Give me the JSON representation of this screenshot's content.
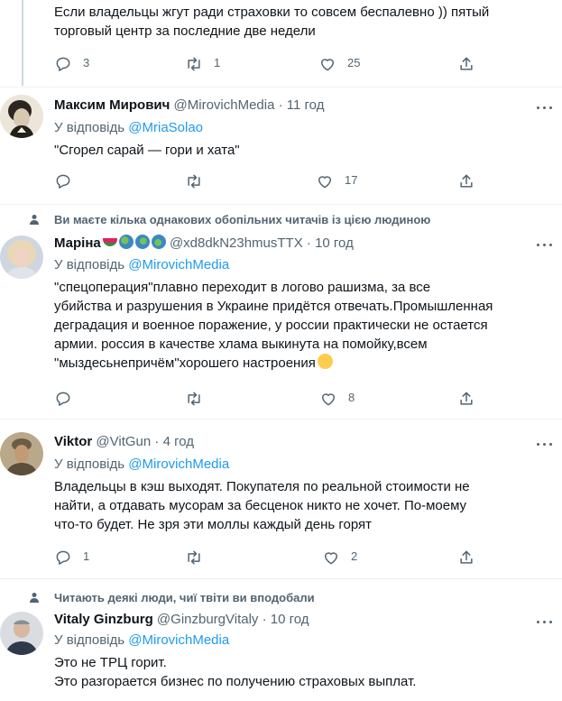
{
  "tweet0": {
    "text_lines": [
      "Если владельцы жгут ради страховки то совсем беспалевно )) пятый",
      "торговый центр за последние две недели"
    ],
    "replies": "3",
    "retweets": "1",
    "likes": "25"
  },
  "tweet1": {
    "name": "Максим Мирович",
    "handle": "@MirovichMedia",
    "dot": "·",
    "time": "11 год",
    "reply_prefix": "У відповідь",
    "reply_to": "@MriaSolao",
    "text_lines": [
      "\"Сгорел сарай — гори и хата\""
    ],
    "replies": "",
    "retweets": "",
    "likes": "17"
  },
  "tweet2": {
    "social_context": "Ви маєте кілька однакових обопільних читачів із цією людиною",
    "name": "Маріна",
    "handle": "@xd8dkN23hmusTTX",
    "dot": "·",
    "time": "10 год",
    "reply_prefix": "У відповідь",
    "reply_to": "@MirovichMedia",
    "text_lines": [
      "\"спецоперация\"плавно переходит в логово рашизма,  за все",
      "убийства и разрушения в Украине придётся отвечать.Промышленная",
      "деградация и военное поражение, у россии практически не остается",
      "армии.  россия в качестве хлама выкинута на помойку,всем",
      "\"мыздесьнепричём\"хорошего настроения"
    ],
    "replies": "",
    "retweets": "",
    "likes": "8"
  },
  "tweet3": {
    "name": "Viktor",
    "handle": "@VitGun",
    "dot": "·",
    "time": "4 год",
    "reply_prefix": "У відповідь",
    "reply_to": "@MirovichMedia",
    "text_lines": [
      "Владельцы в кэш выходят. Покупателя по реальной стоимости не",
      "найти, а отдавать мусорам за бесценок никто не хочет. По-моему",
      "что-то будет. Не зря эти моллы каждый день горят"
    ],
    "replies": "1",
    "retweets": "",
    "likes": "2"
  },
  "tweet4": {
    "social_context": "Читають деякі люди, чиї твіти ви вподобали",
    "name": "Vitaly Ginzburg",
    "handle": "@GinzburgVitaly",
    "dot": "·",
    "time": "10 год",
    "reply_prefix": "У відповідь",
    "reply_to": "@MirovichMedia",
    "text_lines": [
      "Это не ТРЦ горит.",
      "Это разгорается бизнес по получению страховых выплат."
    ]
  },
  "colors": {
    "accent": "#1d9bf0",
    "secondary": "#536471",
    "text": "#0f1419"
  },
  "icons": [
    "reply-icon",
    "retweet-icon",
    "like-icon",
    "share-icon",
    "more-icon",
    "person-icon"
  ]
}
